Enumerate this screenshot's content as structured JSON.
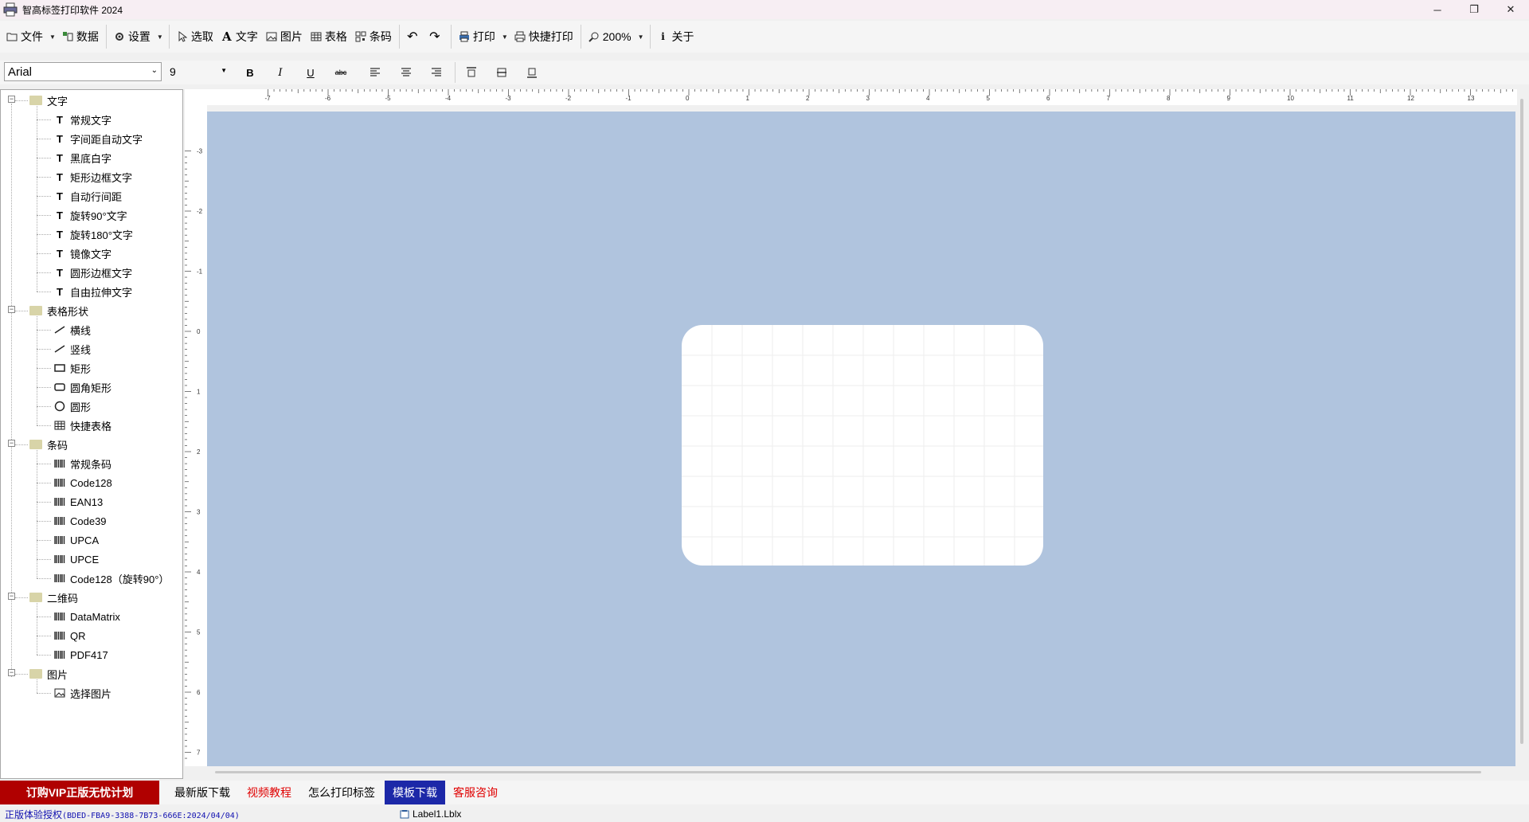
{
  "window": {
    "title": "智高标签打印软件 2024",
    "controls": [
      "─",
      "❐",
      "✕"
    ]
  },
  "toolbar": {
    "file": "文件",
    "data": "数据",
    "settings": "设置",
    "select": "选取",
    "text": "文字",
    "image": "图片",
    "table": "表格",
    "barcode": "条码",
    "print": "打印",
    "quick_print": "快捷打印",
    "zoom": "200%",
    "about": "关于"
  },
  "format": {
    "font": "Arial",
    "size": "9",
    "bold": "B",
    "italic": "I",
    "underline": "U",
    "strike": "abc"
  },
  "tree": {
    "text_group": "文字",
    "text_items": [
      "常规文字",
      "字间距自动文字",
      "黑底白字",
      "矩形边框文字",
      "自动行间距",
      "旋转90°文字",
      "旋转180°文字",
      "镜像文字",
      "圆形边框文字",
      "自由拉伸文字"
    ],
    "shape_group": "表格形状",
    "shape_items": [
      "横线",
      "竖线",
      "矩形",
      "圆角矩形",
      "圆形",
      "快捷表格"
    ],
    "barcode_group": "条码",
    "barcode_items": [
      "常规条码",
      "Code128",
      "EAN13",
      "Code39",
      "UPCA",
      "UPCE",
      "Code128（旋转90°）"
    ],
    "qr_group": "二维码",
    "qr_items": [
      "DataMatrix",
      "QR",
      "PDF417"
    ],
    "image_group": "图片",
    "image_items": [
      "选择图片"
    ]
  },
  "ruler": {
    "h_labels": [
      "-7",
      "-6",
      "-5",
      "-4",
      "-3",
      "-2",
      "-1",
      "0",
      "1",
      "2",
      "3",
      "4",
      "5",
      "6",
      "7",
      "8",
      "9",
      "10",
      "11",
      "12",
      "13"
    ],
    "v_labels": [
      "-3",
      "-2",
      "-1",
      "0",
      "1",
      "2",
      "3",
      "4",
      "5",
      "6",
      "7"
    ]
  },
  "links": {
    "vip": "订购VIP正版无忧计划",
    "latest": "最新版下载",
    "video": "视频教程",
    "howto": "怎么打印标签",
    "template": "模板下载",
    "service": "客服咨询"
  },
  "colors": {
    "canvas_bg": "#b0c4de",
    "vip_bg": "#b00000",
    "template_bg": "#1c28a8",
    "link_red": "#e00000"
  },
  "status": {
    "license_prefix": "正版体验授权",
    "license_code": "(BDED-FBA9-3388-7B73-666E:2024/04/04)",
    "filename": "Label1.Lblx"
  }
}
